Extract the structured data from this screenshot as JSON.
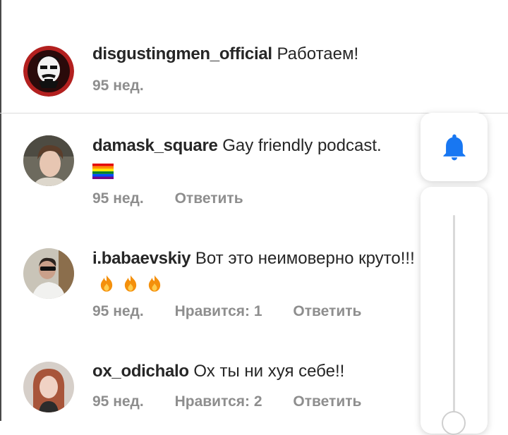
{
  "comments": [
    {
      "username": "disgustingmen_official",
      "text": "Работаем!",
      "age": "95 нед.",
      "likes": "",
      "reply_label": ""
    },
    {
      "username": "damask_square",
      "text": "Gay friendly podcast.",
      "age": "95 нед.",
      "likes": "",
      "reply_label": "Ответить"
    },
    {
      "username": "i.babaevskiy",
      "text": "Вот это неимоверно круто!!!",
      "age": "95 нед.",
      "likes": "Нравится: 1",
      "reply_label": "Ответить"
    },
    {
      "username": "ox_odichalo",
      "text": "Ох ты ни хуя себе!!",
      "age": "95 нед.",
      "likes": "Нравится: 2",
      "reply_label": "Ответить"
    }
  ],
  "colors": {
    "accent_blue": "#1877f2",
    "meta_gray": "#8e8e8e",
    "avatar1_red": "#b3201f"
  },
  "icons": [
    "bell-icon",
    "heart-icon",
    "rainbow-flag-emoji",
    "fire-emoji"
  ]
}
